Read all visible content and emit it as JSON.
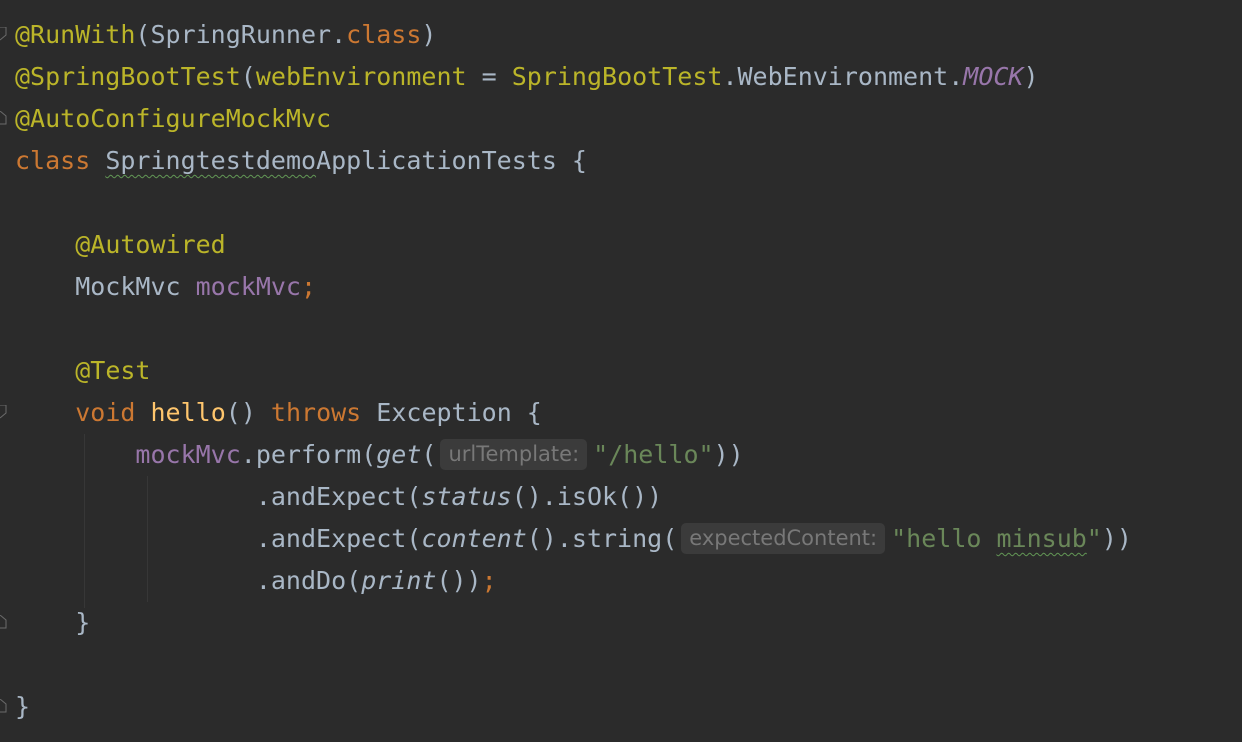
{
  "editor": {
    "lines": [
      {
        "tokens": [
          {
            "t": "@RunWith",
            "c": "ann"
          },
          {
            "t": "(SpringRunner.",
            "c": "plain"
          },
          {
            "t": "class",
            "c": "kw"
          },
          {
            "t": ")",
            "c": "plain"
          }
        ]
      },
      {
        "tokens": [
          {
            "t": "@SpringBootTest",
            "c": "ann"
          },
          {
            "t": "(",
            "c": "plain"
          },
          {
            "t": "webEnvironment",
            "c": "ann"
          },
          {
            "t": " = ",
            "c": "plain"
          },
          {
            "t": "SpringBootTest",
            "c": "ann"
          },
          {
            "t": ".WebEnvironment.",
            "c": "plain"
          },
          {
            "t": "MOCK",
            "c": "const"
          },
          {
            "t": ")",
            "c": "plain"
          }
        ]
      },
      {
        "tokens": [
          {
            "t": "@AutoConfigureMockMvc",
            "c": "ann"
          }
        ]
      },
      {
        "tokens": [
          {
            "t": "class",
            "c": "kw"
          },
          {
            "t": " ",
            "c": "plain"
          },
          {
            "t": "Springtestdemo",
            "c": "plain typo"
          },
          {
            "t": "ApplicationTests {",
            "c": "plain"
          }
        ]
      },
      {
        "tokens": []
      },
      {
        "tokens": [
          {
            "t": "    ",
            "c": "plain"
          },
          {
            "t": "@Autowired",
            "c": "ann"
          }
        ]
      },
      {
        "tokens": [
          {
            "t": "    MockMvc ",
            "c": "plain"
          },
          {
            "t": "mockMvc",
            "c": "field"
          },
          {
            "t": ";",
            "c": "kw"
          }
        ]
      },
      {
        "tokens": []
      },
      {
        "tokens": [
          {
            "t": "    ",
            "c": "plain"
          },
          {
            "t": "@Test",
            "c": "ann"
          }
        ]
      },
      {
        "tokens": [
          {
            "t": "    ",
            "c": "plain"
          },
          {
            "t": "void",
            "c": "kw"
          },
          {
            "t": " ",
            "c": "plain"
          },
          {
            "t": "hello",
            "c": "fn"
          },
          {
            "t": "() ",
            "c": "plain"
          },
          {
            "t": "throws",
            "c": "kw"
          },
          {
            "t": " Exception {",
            "c": "plain"
          }
        ]
      },
      {
        "tokens": [
          {
            "t": "        ",
            "c": "plain"
          },
          {
            "t": "mockMvc",
            "c": "field"
          },
          {
            "t": ".perform(",
            "c": "plain"
          },
          {
            "t": "get",
            "c": "plain static"
          },
          {
            "t": "(",
            "c": "plain"
          },
          {
            "t": "urlTemplate:",
            "c": "hint"
          },
          {
            "t": "\"/hello\"",
            "c": "str"
          },
          {
            "t": "))",
            "c": "plain"
          }
        ]
      },
      {
        "tokens": [
          {
            "t": "                .andExpect(",
            "c": "plain"
          },
          {
            "t": "status",
            "c": "plain static"
          },
          {
            "t": "().isOk())",
            "c": "plain"
          }
        ]
      },
      {
        "tokens": [
          {
            "t": "                .andExpect(",
            "c": "plain"
          },
          {
            "t": "content",
            "c": "plain static"
          },
          {
            "t": "().string(",
            "c": "plain"
          },
          {
            "t": "expectedContent:",
            "c": "hint"
          },
          {
            "t": "\"hello ",
            "c": "str"
          },
          {
            "t": "minsub",
            "c": "str typo"
          },
          {
            "t": "\"",
            "c": "str"
          },
          {
            "t": "))",
            "c": "plain"
          }
        ]
      },
      {
        "tokens": [
          {
            "t": "                .andDo(",
            "c": "plain"
          },
          {
            "t": "print",
            "c": "plain static"
          },
          {
            "t": "())",
            "c": "plain"
          },
          {
            "t": ";",
            "c": "kw"
          }
        ]
      },
      {
        "tokens": [
          {
            "t": "    }",
            "c": "plain"
          }
        ]
      },
      {
        "tokens": []
      },
      {
        "tokens": [
          {
            "t": "}",
            "c": "plain"
          }
        ]
      }
    ]
  }
}
